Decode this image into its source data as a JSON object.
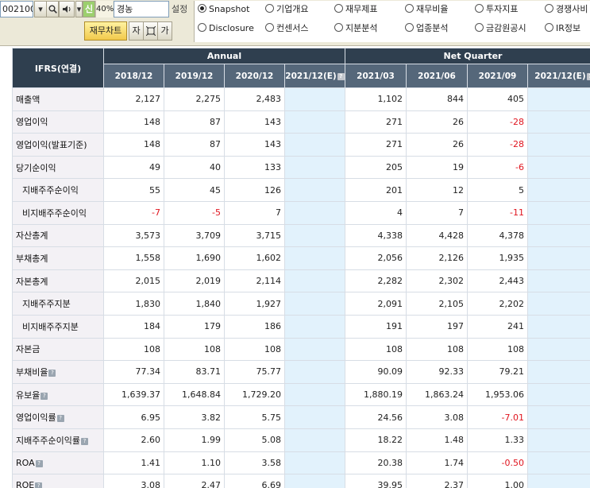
{
  "toolbar": {
    "code": "002100",
    "zoom_pct": "40%",
    "company_name": "경농",
    "setting_label": "설정",
    "chart_button": "재무차트",
    "left_side_buttons": [
      "신"
    ],
    "mini_buttons": [
      "자",
      "ㅁ",
      "가"
    ]
  },
  "report_options": [
    {
      "label": "Snapshot",
      "checked": true
    },
    {
      "label": "기업개요",
      "checked": false
    },
    {
      "label": "재무제표",
      "checked": false
    },
    {
      "label": "재무비율",
      "checked": false
    },
    {
      "label": "투자지표",
      "checked": false
    },
    {
      "label": "경쟁사비",
      "checked": false
    },
    {
      "label": "Disclosure",
      "checked": false
    },
    {
      "label": "컨센서스",
      "checked": false
    },
    {
      "label": "지분분석",
      "checked": false
    },
    {
      "label": "업종분석",
      "checked": false
    },
    {
      "label": "금감원공시",
      "checked": false
    },
    {
      "label": "IR정보",
      "checked": false
    }
  ],
  "table": {
    "corner_label": "IFRS(연결)",
    "groups": [
      "Annual",
      "Net Quarter"
    ],
    "columns": [
      "2018/12",
      "2019/12",
      "2020/12",
      "2021/12(E)",
      "2021/03",
      "2021/06",
      "2021/09",
      "2021/12(E)"
    ],
    "rows": [
      {
        "label": "매출액",
        "sub": false,
        "help": false,
        "values": [
          "2,127",
          "2,275",
          "2,483",
          "",
          "1,102",
          "844",
          "405",
          ""
        ]
      },
      {
        "label": "영업이익",
        "sub": false,
        "help": false,
        "values": [
          "148",
          "87",
          "143",
          "",
          "271",
          "26",
          "-28",
          ""
        ]
      },
      {
        "label": "영업이익(발표기준)",
        "sub": false,
        "help": false,
        "values": [
          "148",
          "87",
          "143",
          "",
          "271",
          "26",
          "-28",
          ""
        ]
      },
      {
        "label": "당기순이익",
        "sub": false,
        "help": false,
        "values": [
          "49",
          "40",
          "133",
          "",
          "205",
          "19",
          "-6",
          ""
        ]
      },
      {
        "label": "지배주주순이익",
        "sub": true,
        "help": false,
        "values": [
          "55",
          "45",
          "126",
          "",
          "201",
          "12",
          "5",
          ""
        ]
      },
      {
        "label": "비지배주주순이익",
        "sub": true,
        "help": false,
        "values": [
          "-7",
          "-5",
          "7",
          "",
          "4",
          "7",
          "-11",
          ""
        ]
      },
      {
        "label": "자산총계",
        "sub": false,
        "help": false,
        "values": [
          "3,573",
          "3,709",
          "3,715",
          "",
          "4,338",
          "4,428",
          "4,378",
          ""
        ]
      },
      {
        "label": "부채총계",
        "sub": false,
        "help": false,
        "values": [
          "1,558",
          "1,690",
          "1,602",
          "",
          "2,056",
          "2,126",
          "1,935",
          ""
        ]
      },
      {
        "label": "자본총계",
        "sub": false,
        "help": false,
        "values": [
          "2,015",
          "2,019",
          "2,114",
          "",
          "2,282",
          "2,302",
          "2,443",
          ""
        ]
      },
      {
        "label": "지배주주지분",
        "sub": true,
        "help": false,
        "values": [
          "1,830",
          "1,840",
          "1,927",
          "",
          "2,091",
          "2,105",
          "2,202",
          ""
        ]
      },
      {
        "label": "비지배주주지분",
        "sub": true,
        "help": false,
        "values": [
          "184",
          "179",
          "186",
          "",
          "191",
          "197",
          "241",
          ""
        ]
      },
      {
        "label": "자본금",
        "sub": false,
        "help": false,
        "values": [
          "108",
          "108",
          "108",
          "",
          "108",
          "108",
          "108",
          ""
        ]
      },
      {
        "label": "부채비율",
        "sub": false,
        "help": true,
        "values": [
          "77.34",
          "83.71",
          "75.77",
          "",
          "90.09",
          "92.33",
          "79.21",
          ""
        ]
      },
      {
        "label": "유보율",
        "sub": false,
        "help": true,
        "values": [
          "1,639.37",
          "1,648.84",
          "1,729.20",
          "",
          "1,880.19",
          "1,863.24",
          "1,953.06",
          ""
        ]
      },
      {
        "label": "영업이익률",
        "sub": false,
        "help": true,
        "values": [
          "6.95",
          "3.82",
          "5.75",
          "",
          "24.56",
          "3.08",
          "-7.01",
          ""
        ]
      },
      {
        "label": "지배주주순이익률",
        "sub": false,
        "help": true,
        "values": [
          "2.60",
          "1.99",
          "5.08",
          "",
          "18.22",
          "1.48",
          "1.33",
          ""
        ]
      },
      {
        "label": "ROA",
        "sub": false,
        "help": true,
        "values": [
          "1.41",
          "1.10",
          "3.58",
          "",
          "20.38",
          "1.74",
          "-0.50",
          ""
        ]
      },
      {
        "label": "ROE",
        "sub": false,
        "help": true,
        "values": [
          "3.08",
          "2.47",
          "6.69",
          "",
          "39.95",
          "2.37",
          "1.00",
          ""
        ]
      }
    ]
  },
  "colors": {
    "header_dark": "#2f3f4f",
    "header_sub": "#55677a",
    "estimate_column": "#e2f2fc",
    "negative": "#e0141e",
    "label_bg": "#f3f1f5"
  }
}
